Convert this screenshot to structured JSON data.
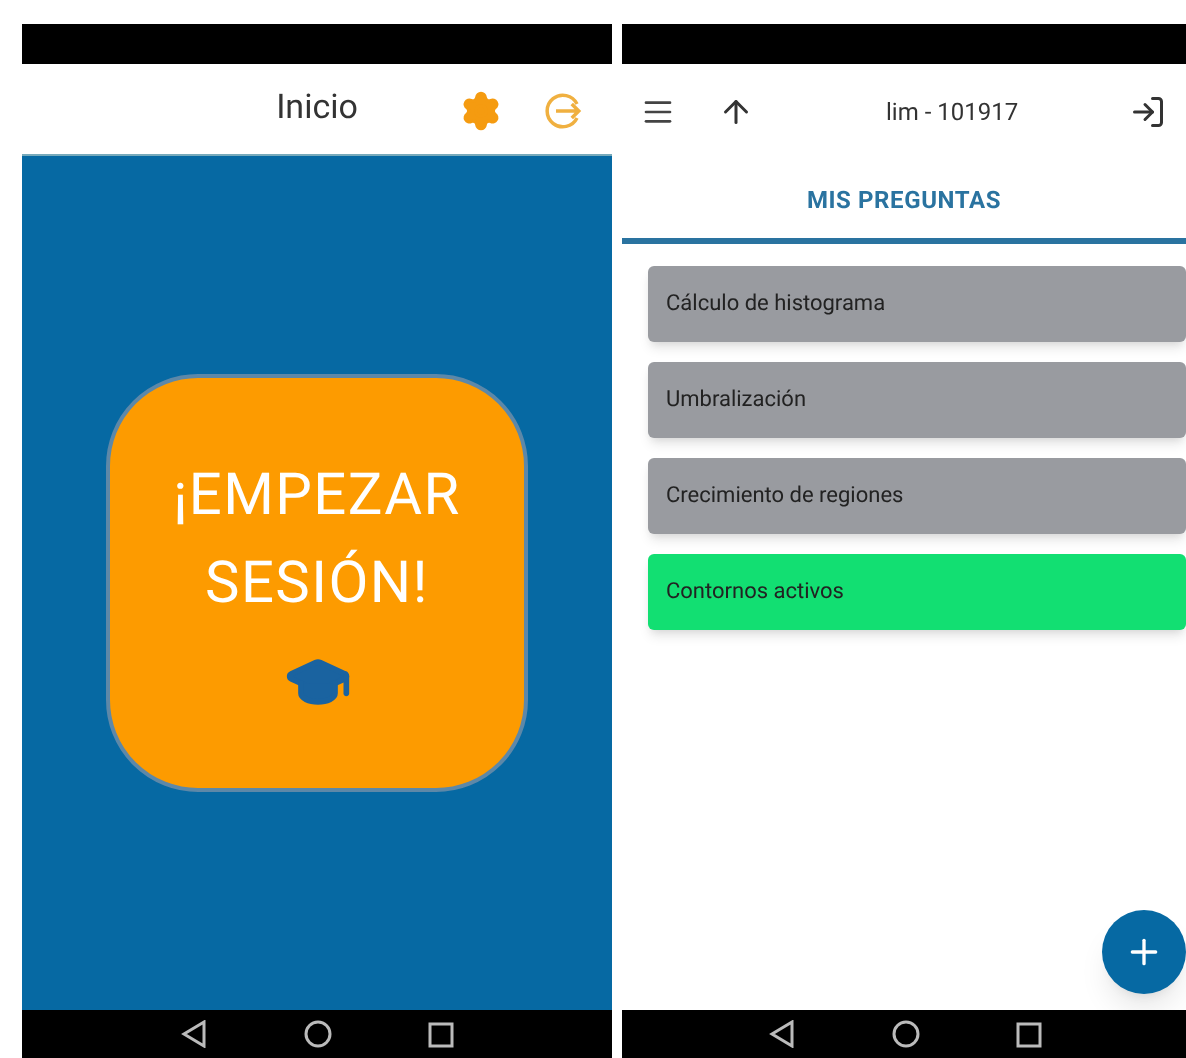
{
  "home_screen": {
    "title": "Inicio",
    "start_button": {
      "label": "¡EMPEZAR SESIÓN!"
    }
  },
  "questions_screen": {
    "title": "lim - 101917",
    "tabs": [
      {
        "label": "MIS PREGUNTAS",
        "selected": true
      }
    ],
    "questions": [
      {
        "label": "Cálculo de histograma",
        "color": "#999ba0"
      },
      {
        "label": "Umbralización",
        "color": "#999ba0"
      },
      {
        "label": "Crecimiento de regiones",
        "color": "#999ba0"
      },
      {
        "label": "Contornos activos",
        "color": "#12df72"
      }
    ]
  }
}
